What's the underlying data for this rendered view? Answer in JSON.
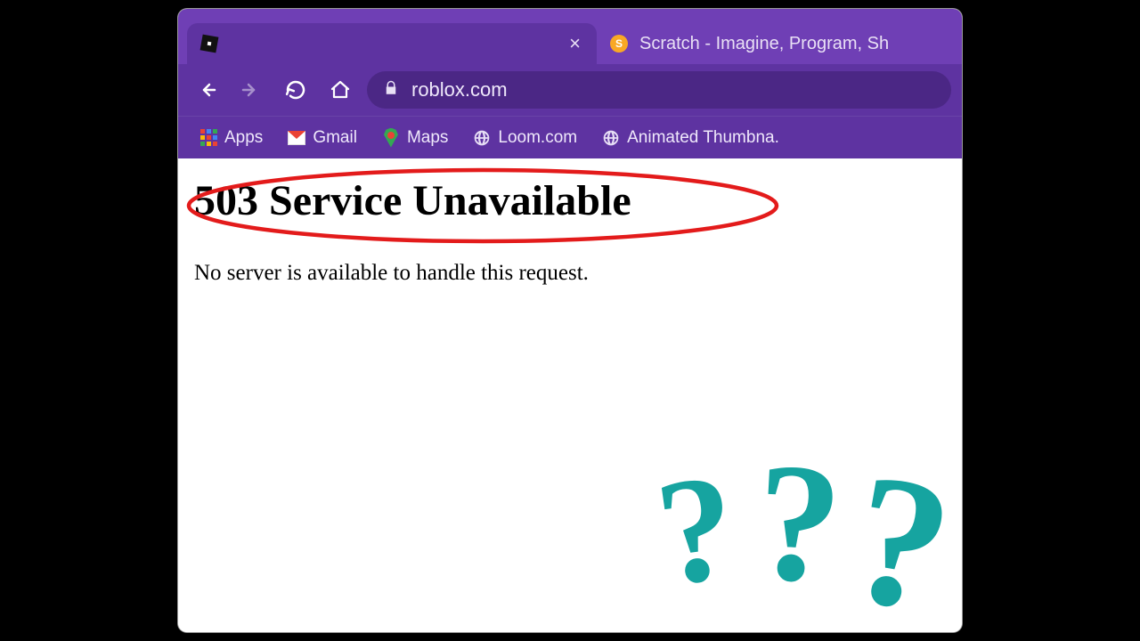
{
  "tabs": {
    "active": {
      "title": ""
    },
    "inactive": {
      "title": "Scratch - Imagine, Program, Sh"
    }
  },
  "address": {
    "url": "roblox.com"
  },
  "bookmarks": {
    "apps": "Apps",
    "gmail": "Gmail",
    "maps": "Maps",
    "loom": "Loom.com",
    "animated": "Animated Thumbna."
  },
  "page": {
    "heading": "503 Service Unavailable",
    "body": "No server is available to handle this request."
  },
  "overlay": {
    "q1": "?",
    "q2": "?",
    "q3": "?"
  }
}
